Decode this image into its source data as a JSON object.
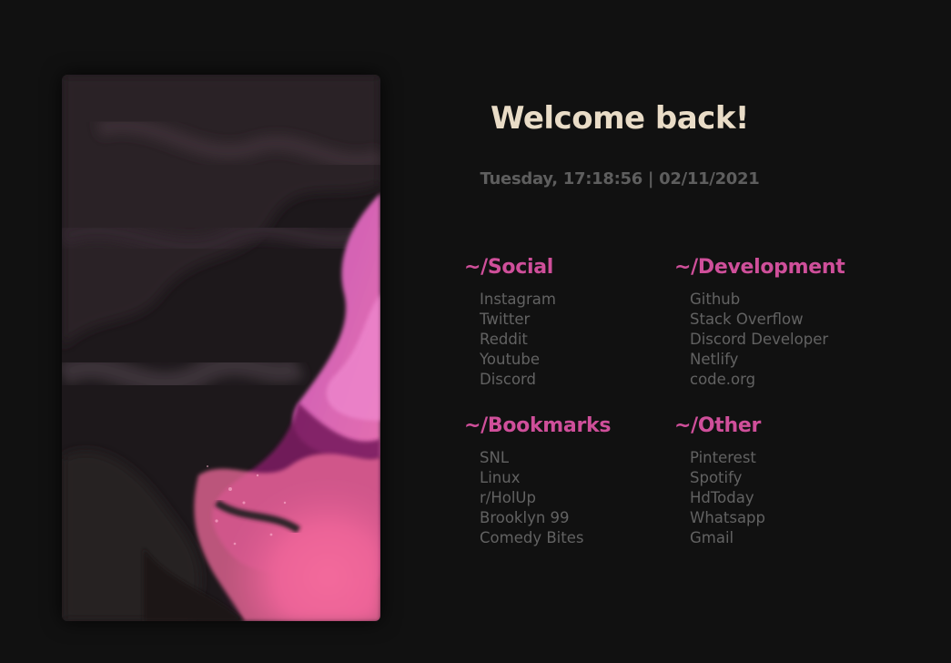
{
  "welcome": "Welcome back!",
  "clock": "Tuesday, 17:18:56 | 02/11/2021",
  "colors": {
    "background": "#111111",
    "heading": "#e9dcc7",
    "accent": "#cf4f9a",
    "link": "#626262",
    "clock": "#5e5e5e"
  },
  "groups": [
    {
      "title": "~/Social",
      "links": [
        "Instagram",
        "Twitter",
        "Reddit",
        "Youtube",
        "Discord"
      ]
    },
    {
      "title": "~/Development",
      "links": [
        "Github",
        "Stack Overflow",
        "Discord Developer",
        "Netlify",
        "code.org"
      ]
    },
    {
      "title": "~/Bookmarks",
      "links": [
        "SNL",
        "Linux",
        "r/HolUp",
        "Brooklyn 99",
        "Comedy Bites"
      ]
    },
    {
      "title": "~/Other",
      "links": [
        "Pinterest",
        "Spotify",
        "HdToday",
        "Whatsapp",
        "Gmail"
      ]
    }
  ]
}
